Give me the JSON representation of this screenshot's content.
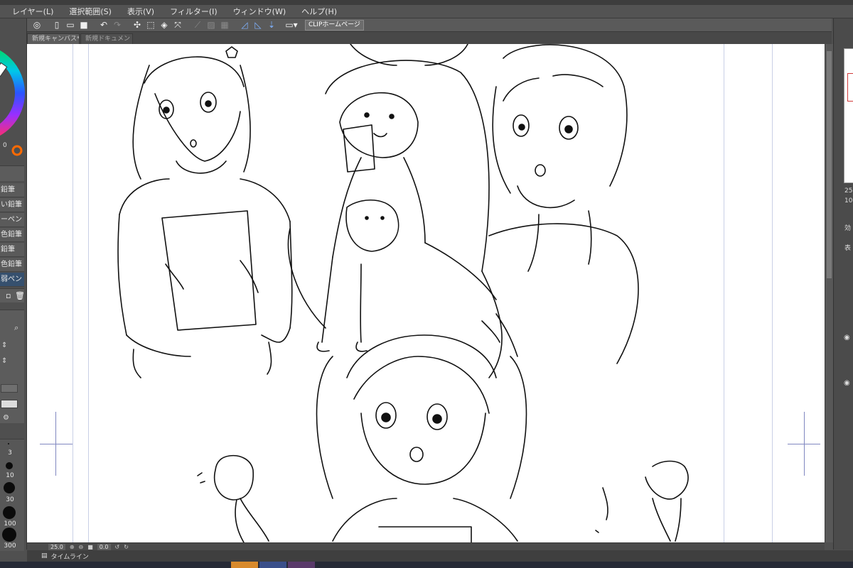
{
  "menubar": {
    "items": [
      "レイヤー(L)",
      "選択範囲(S)",
      "表示(V)",
      "フィルター(I)",
      "ウィンドウ(W)",
      "ヘルプ(H)"
    ]
  },
  "commandbar": {
    "icons": [
      "clip-studio-icon",
      "new-file-icon",
      "open-file-icon",
      "save-icon",
      "undo-icon",
      "redo-icon",
      "transform-icon",
      "select-all-icon",
      "fill-icon",
      "expand-icon",
      "ruler-icon",
      "ruler-off-icon",
      "snap-icon",
      "snap-ruler-icon",
      "snap-special-icon",
      "snap-grid-icon",
      "monitor-icon"
    ],
    "clip_button_label": "CLIPホームページ"
  },
  "tabs": [
    {
      "label": "新規キャンバス*",
      "active": true
    },
    {
      "label": "新規ドキュメント-",
      "active": false
    }
  ],
  "left_panel": {
    "color_value_label": "0",
    "brushes": [
      {
        "label": "鉛筆",
        "selected": false
      },
      {
        "label": "い鉛筆",
        "selected": false
      },
      {
        "label": "ーペン",
        "selected": false
      },
      {
        "label": "色鉛筆",
        "selected": false
      },
      {
        "label": "鉛筆",
        "selected": false
      },
      {
        "label": "色鉛筆 2",
        "selected": false
      },
      {
        "label": "弱ペン",
        "selected": true
      }
    ],
    "brush_sizes": [
      "3",
      "10",
      "30",
      "100",
      "300"
    ]
  },
  "right_panel": {
    "labels": [
      "25",
      "10",
      "効",
      "表"
    ]
  },
  "statusbar": {
    "zoom": "25.0",
    "angle": "0.0"
  },
  "timeline": {
    "label": "タイムライン"
  },
  "colors": {
    "accent_blue": "#36506e",
    "canvas_bg": "#ffffff",
    "guide_line": "#8087c0"
  }
}
